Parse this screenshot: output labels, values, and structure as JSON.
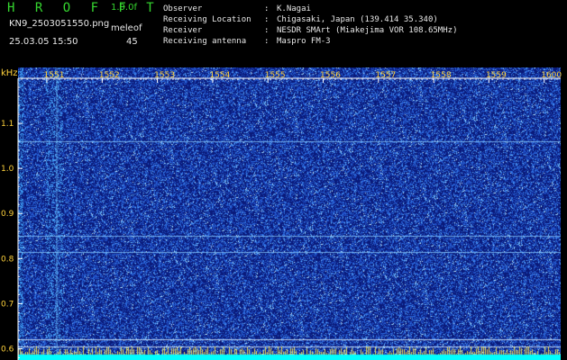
{
  "header": {
    "app_title": "H R O F F T",
    "version": "1.0.0f",
    "filename": "KN9_2503051550.png",
    "timestamp": "25.03.05 15:50",
    "meleof_label": "meleof",
    "meleof_value": "45",
    "info": [
      {
        "key": "Observer",
        "value": "K.Nagai"
      },
      {
        "key": "Receiving Location",
        "value": "Chigasaki, Japan (139.414 35.340)"
      },
      {
        "key": "Receiver",
        "value": "NESDR SMArt (Miakejima VOR 108.65MHz)"
      },
      {
        "key": "Receiving antenna",
        "value": "Maspro FM-3"
      }
    ]
  },
  "chart_data": {
    "type": "heatmap",
    "title": "",
    "ylabel": "kHz",
    "xlabel": "",
    "x_ticks": [
      "1551",
      "1552",
      "1553",
      "1554",
      "1555",
      "1556",
      "1557",
      "1558",
      "1559",
      "1600"
    ],
    "x_range": [
      1550.8,
      1600.3
    ],
    "y_ticks": [
      1.1,
      1.0,
      0.9,
      0.8,
      0.7,
      0.6
    ],
    "y_tick_labels": [
      "1.1",
      "1.0",
      "0.9",
      "0.8",
      "0.7",
      "0.6"
    ],
    "y_range": [
      0.575,
      1.2
    ],
    "horizontal_lines_khz": [
      1.06,
      0.85,
      0.815,
      0.62,
      0.605
    ],
    "colors": {
      "background": "#0a1a7a",
      "noise": "#2d5bd9",
      "signal": "#8fd0ff",
      "axis": "#ffffff",
      "tick_label": "#ffd23c",
      "bottom_band": "#00ffff"
    }
  }
}
